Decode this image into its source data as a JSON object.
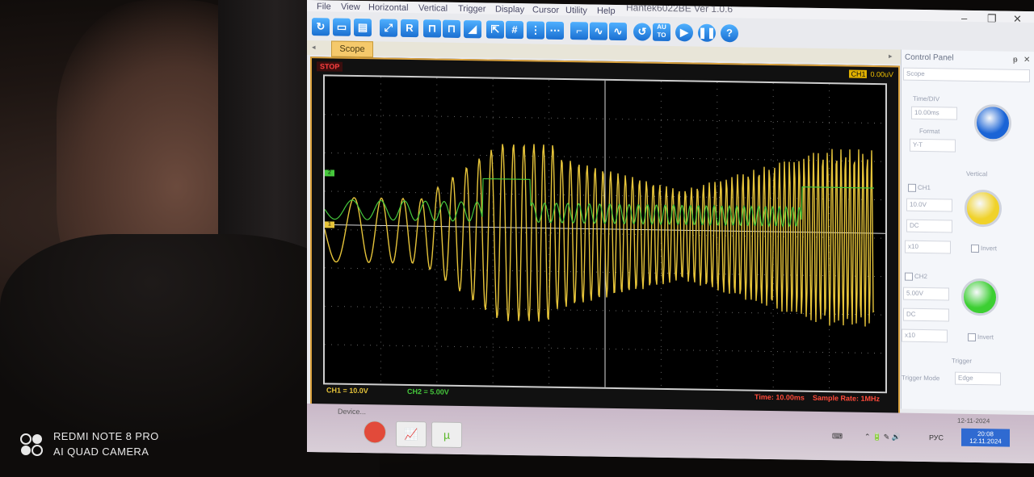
{
  "window": {
    "title": "Hantek6022BE Ver 1.0.6",
    "minimize": "–",
    "maximize": "❐",
    "close": "✕"
  },
  "menu": [
    "File",
    "View",
    "Horizontal",
    "Vertical",
    "Trigger",
    "Display",
    "Cursor",
    "Utility",
    "Help"
  ],
  "toolbar_icons": [
    "open-icon",
    "save-icon",
    "print-icon",
    "auto-set-icon",
    "r-icon",
    "pulse-icon",
    "pulse2-icon",
    "ramp-icon",
    "cursor-icon",
    "grid-icon",
    "channel-icon",
    "ellipsis-icon",
    "step-icon",
    "sine-icon",
    "sine2-icon",
    "refresh-icon",
    "auto-icon",
    "play-icon",
    "pause-icon",
    "help-icon"
  ],
  "tab": {
    "label": "Scope"
  },
  "scope": {
    "run_state": "STOP",
    "trigger_source": "CH1",
    "trigger_level": "0.00uV",
    "ch1_marker": "1",
    "ch2_marker": "2",
    "ch1_status": "CH1 = 10.0V",
    "ch2_status": "CH2 = 5.00V",
    "time_status": "Time: 10.00ms",
    "sample_rate": "Sample Rate: 1MHz",
    "ch1_color": "#e6c43a",
    "ch2_color": "#46c83c"
  },
  "control_panel": {
    "title": "Control Panel",
    "pin": "ᵽ",
    "close": "✕",
    "mode": "Scope",
    "time_div_label": "Time/DIV",
    "time_div": "10.00ms",
    "format_label": "Format",
    "format": "Y-T",
    "vertical_label": "Vertical",
    "ch1_label": "CH1",
    "ch1_volts": "10.0V",
    "ch1_coupling": "DC",
    "ch1_probe": "x10",
    "ch1_invert": "Invert",
    "ch2_label": "CH2",
    "ch2_volts": "5.00V",
    "ch2_coupling": "DC",
    "ch2_probe": "x10",
    "ch2_invert": "Invert",
    "trigger_label": "Trigger",
    "trigger_mode_label": "Trigger Mode",
    "trigger_mode": "Edge",
    "knob_time_color": "#1a64d6",
    "knob_ch1_color": "#f0d22a",
    "knob_ch2_color": "#3ccf32"
  },
  "taskbar": {
    "device": "Device...",
    "lang": "РУС",
    "time": "20:08",
    "date": "12.11.2024",
    "partial_date": "12-11-2024"
  },
  "watermark": {
    "line1": "REDMI NOTE 8 PRO",
    "line2": "AI QUAD CAMERA"
  }
}
